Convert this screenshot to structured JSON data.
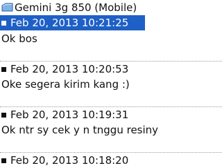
{
  "header": {
    "contact": "Gemini 3g 850 (Mobile)",
    "icon": "contact-card-icon"
  },
  "messages": [
    {
      "timestamp": "Feb 20, 2013 10:21:25",
      "text": "Ok bos",
      "selected": true
    },
    {
      "timestamp": "Feb 20, 2013 10:20:53",
      "text": "Oke segera kirim kang :)",
      "selected": false
    },
    {
      "timestamp": "Feb 20, 2013 10:19:31",
      "text": "Ok ntr sy cek y n tnggu resiny",
      "selected": false
    },
    {
      "timestamp": "Feb 20, 2013 10:18:20",
      "text": "",
      "selected": false
    }
  ],
  "colors": {
    "selection": "#1f60c6",
    "separator": "#9a9a9a"
  }
}
